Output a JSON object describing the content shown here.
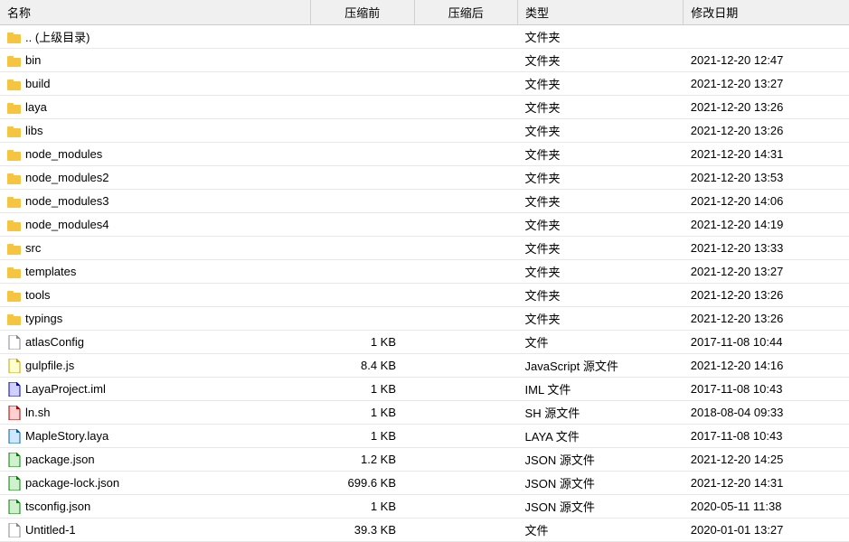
{
  "table": {
    "headers": {
      "name": "名称",
      "compressed_before": "压缩前",
      "compressed_after": "压缩后",
      "type": "类型",
      "date": "修改日期"
    },
    "rows": [
      {
        "name": ".. (上级目录)",
        "icon": "parent",
        "compressed_before": "",
        "compressed_after": "",
        "type": "文件夹",
        "date": ""
      },
      {
        "name": "bin",
        "icon": "folder",
        "compressed_before": "",
        "compressed_after": "",
        "type": "文件夹",
        "date": "2021-12-20 12:47"
      },
      {
        "name": "build",
        "icon": "folder",
        "compressed_before": "",
        "compressed_after": "",
        "type": "文件夹",
        "date": "2021-12-20 13:27"
      },
      {
        "name": "laya",
        "icon": "folder",
        "compressed_before": "",
        "compressed_after": "",
        "type": "文件夹",
        "date": "2021-12-20 13:26"
      },
      {
        "name": "libs",
        "icon": "folder",
        "compressed_before": "",
        "compressed_after": "",
        "type": "文件夹",
        "date": "2021-12-20 13:26"
      },
      {
        "name": "node_modules",
        "icon": "folder",
        "compressed_before": "",
        "compressed_after": "",
        "type": "文件夹",
        "date": "2021-12-20 14:31"
      },
      {
        "name": "node_modules2",
        "icon": "folder",
        "compressed_before": "",
        "compressed_after": "",
        "type": "文件夹",
        "date": "2021-12-20 13:53"
      },
      {
        "name": "node_modules3",
        "icon": "folder",
        "compressed_before": "",
        "compressed_after": "",
        "type": "文件夹",
        "date": "2021-12-20 14:06"
      },
      {
        "name": "node_modules4",
        "icon": "folder",
        "compressed_before": "",
        "compressed_after": "",
        "type": "文件夹",
        "date": "2021-12-20 14:19"
      },
      {
        "name": "src",
        "icon": "folder",
        "compressed_before": "",
        "compressed_after": "",
        "type": "文件夹",
        "date": "2021-12-20 13:33"
      },
      {
        "name": "templates",
        "icon": "folder",
        "compressed_before": "",
        "compressed_after": "",
        "type": "文件夹",
        "date": "2021-12-20 13:27"
      },
      {
        "name": "tools",
        "icon": "folder",
        "compressed_before": "",
        "compressed_after": "",
        "type": "文件夹",
        "date": "2021-12-20 13:26"
      },
      {
        "name": "typings",
        "icon": "folder",
        "compressed_before": "",
        "compressed_after": "",
        "type": "文件夹",
        "date": "2021-12-20 13:26"
      },
      {
        "name": "atlasConfig",
        "icon": "file",
        "compressed_before": "1 KB",
        "compressed_after": "",
        "type": "文件",
        "date": "2017-11-08 10:44"
      },
      {
        "name": "gulpfile.js",
        "icon": "js",
        "compressed_before": "8.4 KB",
        "compressed_after": "",
        "type": "JavaScript 源文件",
        "date": "2021-12-20 14:16"
      },
      {
        "name": "LayaProject.iml",
        "icon": "iml",
        "compressed_before": "1 KB",
        "compressed_after": "",
        "type": "IML 文件",
        "date": "2017-11-08 10:43"
      },
      {
        "name": "ln.sh",
        "icon": "sh",
        "compressed_before": "1 KB",
        "compressed_after": "",
        "type": "SH 源文件",
        "date": "2018-08-04 09:33"
      },
      {
        "name": "MapleStory.laya",
        "icon": "laya",
        "compressed_before": "1 KB",
        "compressed_after": "",
        "type": "LAYA 文件",
        "date": "2017-11-08 10:43"
      },
      {
        "name": "package.json",
        "icon": "json",
        "compressed_before": "1.2 KB",
        "compressed_after": "",
        "type": "JSON 源文件",
        "date": "2021-12-20 14:25"
      },
      {
        "name": "package-lock.json",
        "icon": "json",
        "compressed_before": "699.6 KB",
        "compressed_after": "",
        "type": "JSON 源文件",
        "date": "2021-12-20 14:31"
      },
      {
        "name": "tsconfig.json",
        "icon": "json",
        "compressed_before": "1 KB",
        "compressed_after": "",
        "type": "JSON 源文件",
        "date": "2020-05-11 11:38"
      },
      {
        "name": "Untitled-1",
        "icon": "file",
        "compressed_before": "39.3 KB",
        "compressed_after": "",
        "type": "文件",
        "date": "2020-01-01 13:27"
      }
    ]
  }
}
